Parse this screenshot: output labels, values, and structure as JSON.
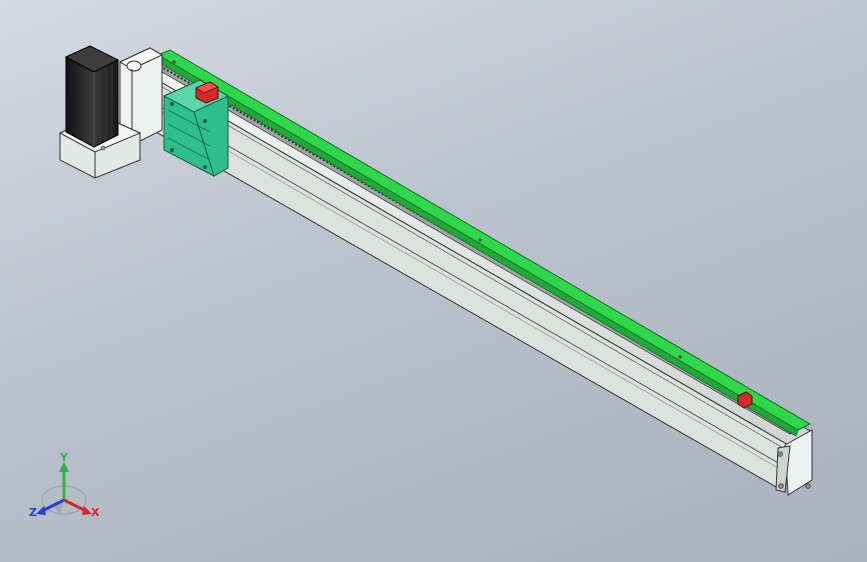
{
  "triad": {
    "x_label": "X",
    "y_label": "Y",
    "z_label": "Z",
    "x_color": "#d8262a",
    "y_color": "#2fb34a",
    "z_color": "#2a3fd6"
  },
  "colors": {
    "rail": "#2fd84a",
    "carriage": "#2fbf8f",
    "motor": "#2a2a2a",
    "housing": "#e8ecea",
    "stop_block": "#d42a2a"
  }
}
